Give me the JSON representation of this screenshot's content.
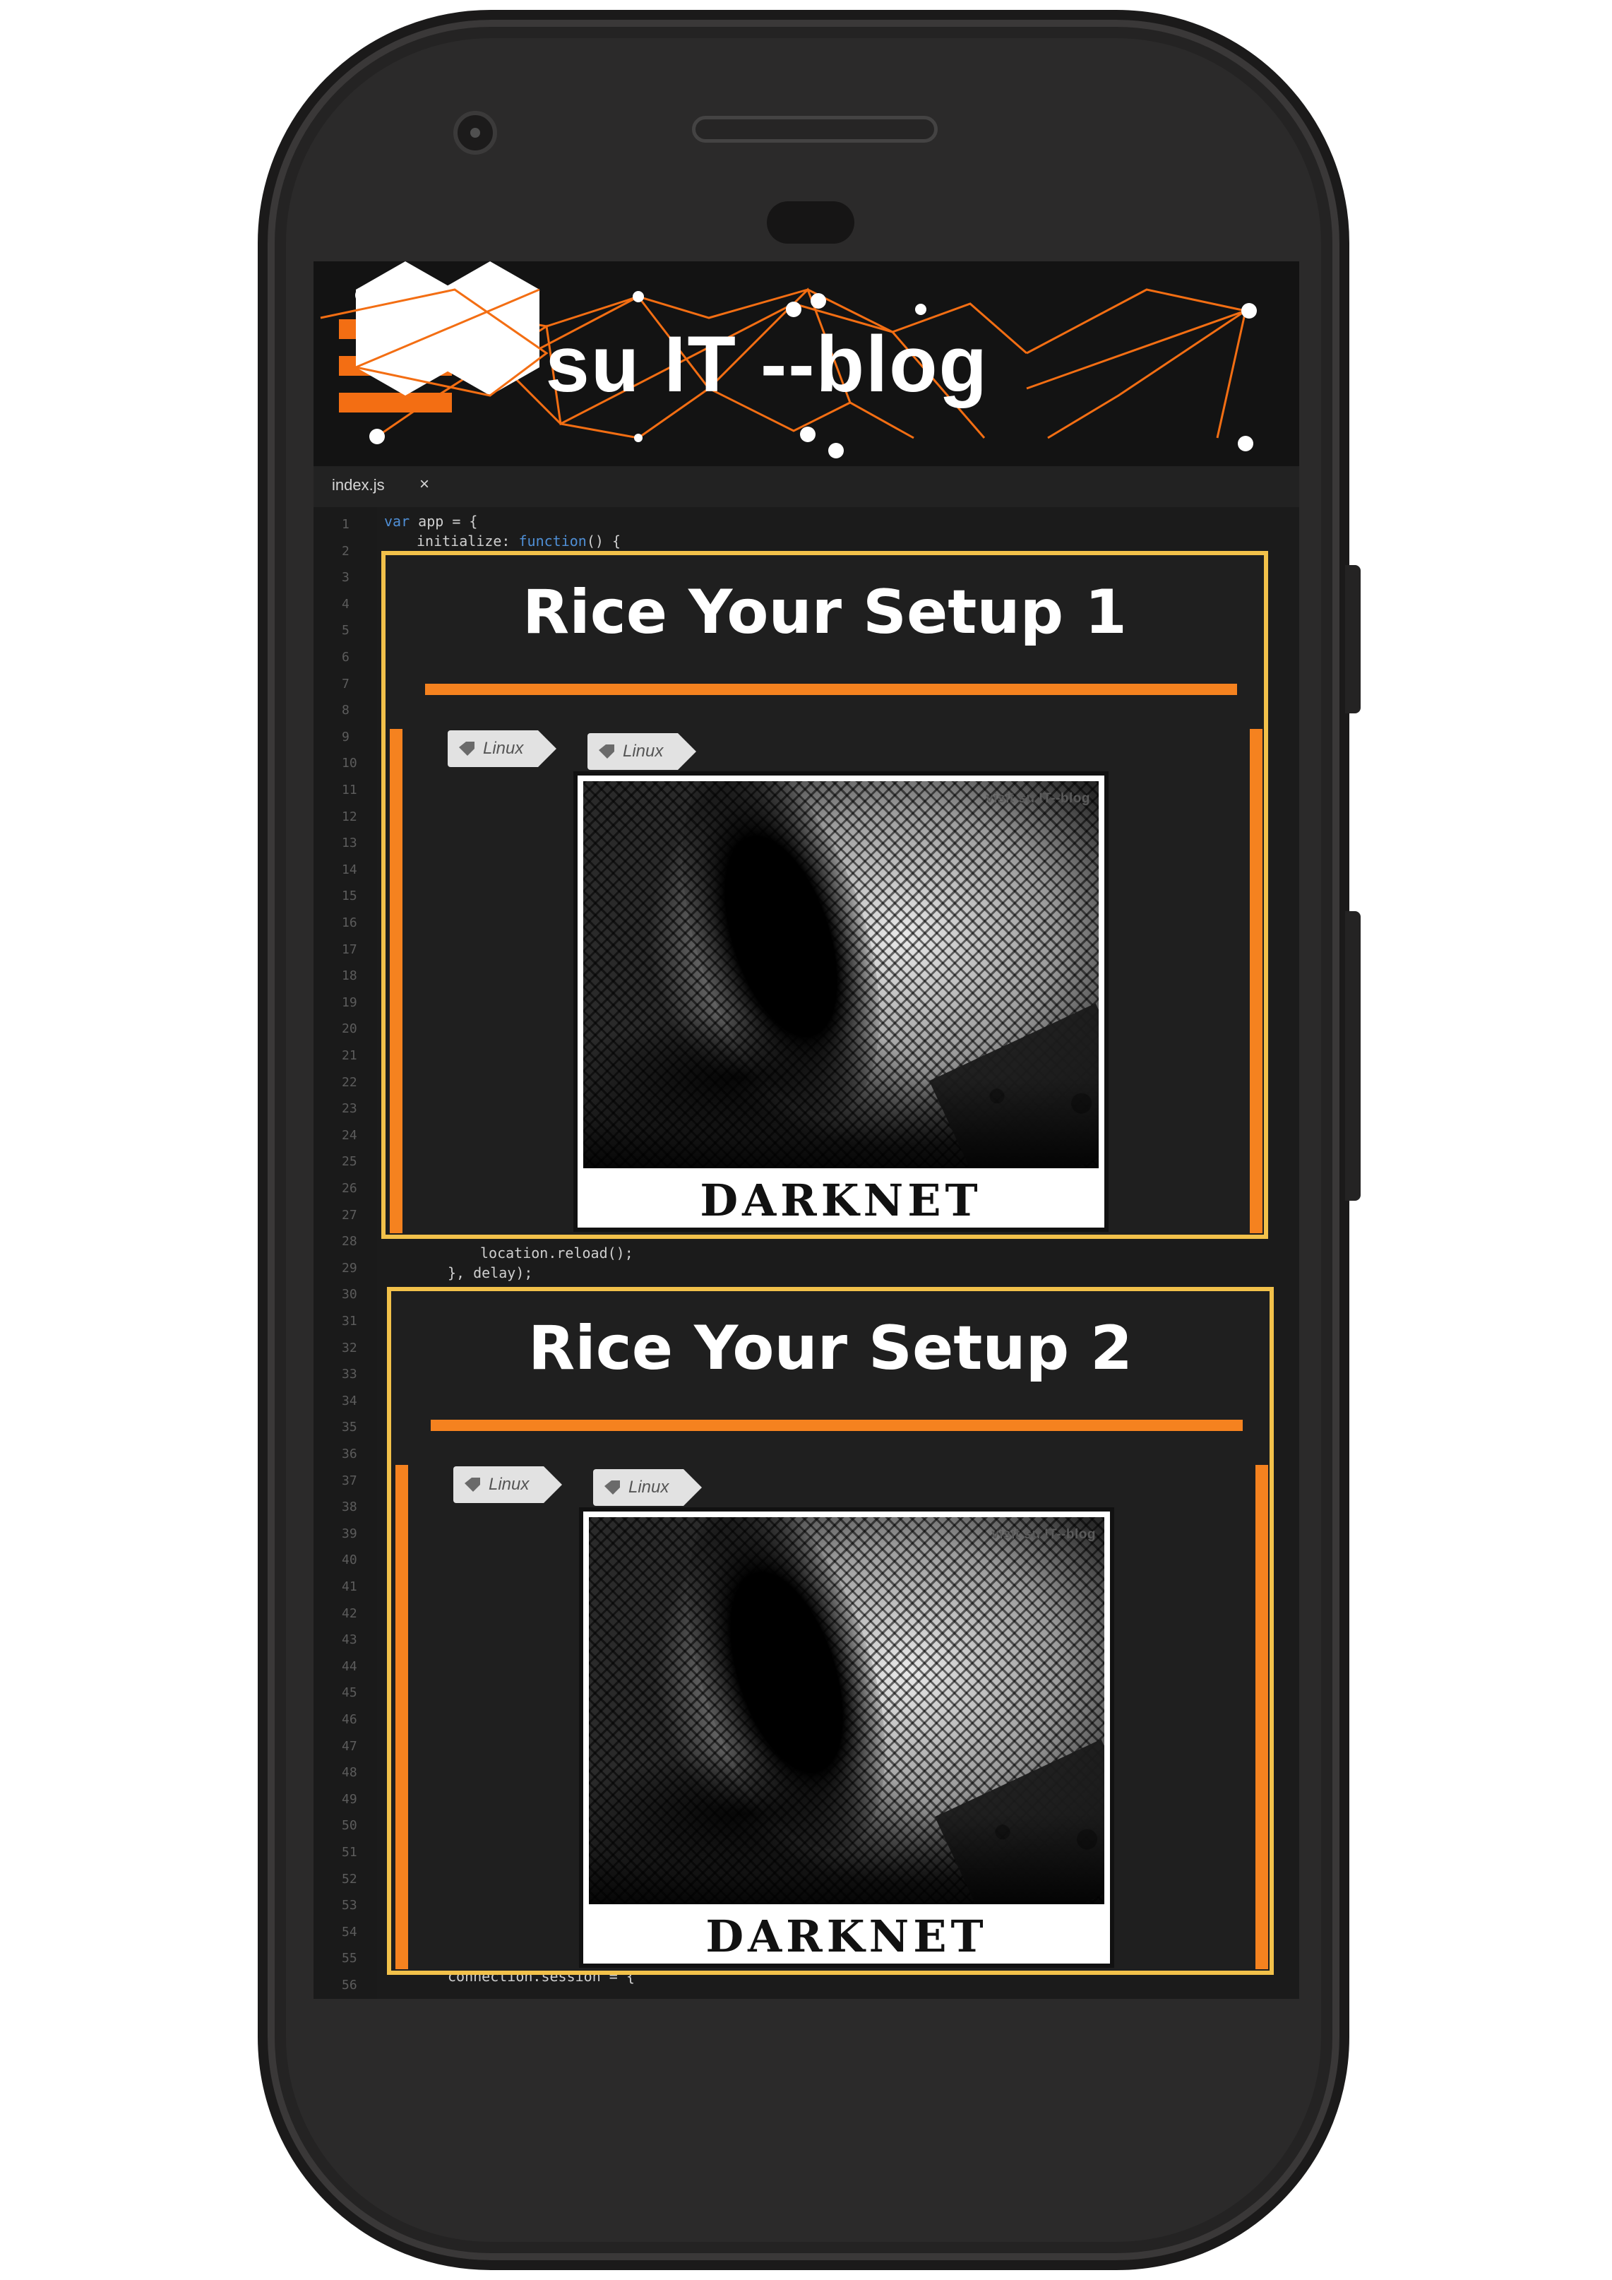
{
  "colors": {
    "accent": "#f5821f",
    "card_border": "#f2c14a",
    "screen_bg": "#1b1b1b",
    "header_bg": "#131313",
    "tag_bg": "#e2e2e2"
  },
  "header": {
    "title": "> su IT --blog",
    "menu_icon": "hamburger-menu-icon"
  },
  "editor": {
    "tab_label": "index.js",
    "tab_close": "×",
    "line_numbers": [
      "1",
      "2",
      "3",
      "4",
      "5",
      "6",
      "7",
      "8",
      "9",
      "10",
      "11",
      "12",
      "13",
      "14",
      "15",
      "16",
      "17",
      "18",
      "19",
      "20",
      "21",
      "22",
      "23",
      "24",
      "25",
      "26",
      "27",
      "28",
      "29",
      "30",
      "31",
      "32",
      "33",
      "34",
      "35",
      "36",
      "37",
      "38",
      "39",
      "40",
      "41",
      "42",
      "43",
      "44",
      "45",
      "46",
      "47",
      "48",
      "49",
      "50",
      "51",
      "52",
      "53",
      "54",
      "55",
      "56"
    ],
    "code_line_1": "var app = {",
    "code_line_2": "initialize: function() {",
    "code_line_29": "location.reload();",
    "code_line_30": "}, delay);",
    "code_line_56": "connection.session = {"
  },
  "posts": [
    {
      "title": "Rice Your Setup 1",
      "tags": [
        "Linux",
        "Linux"
      ],
      "watermark": "visit su IT--blog",
      "caption": "DARKNET"
    },
    {
      "title": "Rice Your Setup 2",
      "tags": [
        "Linux",
        "Linux"
      ],
      "watermark": "visit su IT--blog",
      "caption": "DARKNET"
    }
  ]
}
